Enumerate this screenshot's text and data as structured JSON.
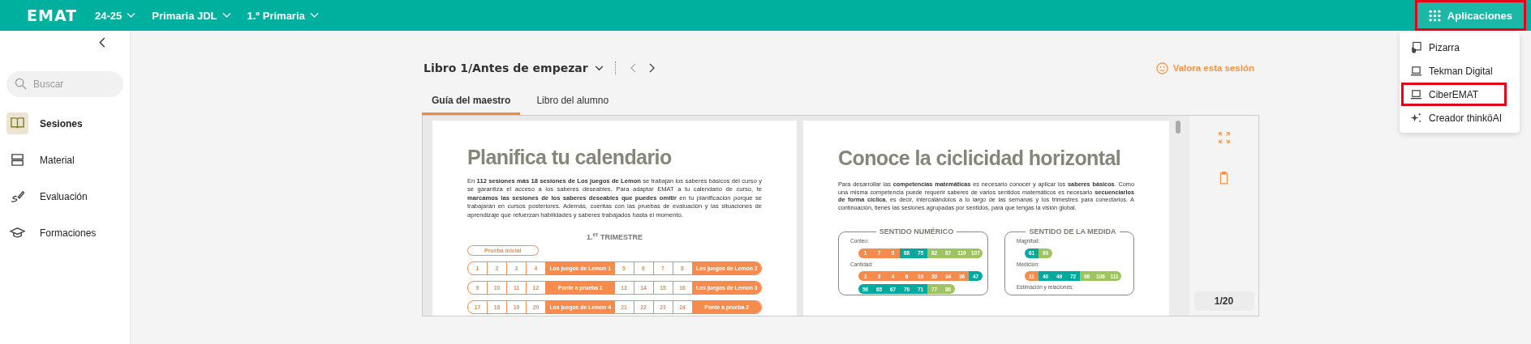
{
  "topbar": {
    "logo": "EMAT",
    "selectors": [
      {
        "label": "24-25"
      },
      {
        "label": "Primaria JDL"
      },
      {
        "label": "1.º Primaria"
      }
    ],
    "apps_button": {
      "label": "Aplicaciones",
      "highlighted": true
    }
  },
  "apps_menu": [
    {
      "label": "Pizarra",
      "kind": "board",
      "highlighted": false
    },
    {
      "label": "Tekman Digital",
      "kind": "laptop",
      "highlighted": false
    },
    {
      "label": "CiberEMAT",
      "kind": "laptop",
      "highlighted": true
    },
    {
      "label": "Creador thinköAI",
      "kind": "sparkle",
      "highlighted": false
    }
  ],
  "sidebar": {
    "search": {
      "placeholder": "Buscar"
    },
    "items": [
      {
        "label": "Sesiones",
        "kind": "book",
        "selected": true
      },
      {
        "label": "Material",
        "kind": "stack",
        "selected": false
      },
      {
        "label": "Evaluación",
        "kind": "pen",
        "selected": false
      },
      {
        "label": "Formaciones",
        "kind": "cap",
        "selected": false
      }
    ]
  },
  "header": {
    "breadcrumb": "Libro 1/Antes de empezar",
    "rate": "Valora esta sesión"
  },
  "tabs": [
    {
      "label": "Guía del maestro",
      "selected": true
    },
    {
      "label": "Libro del alumno",
      "selected": false
    }
  ],
  "viewer": {
    "page_counter": "1/20",
    "left_page": {
      "title": "Planifica tu calendario",
      "paragraph": "En **112 sesiones más 18 sesiones de Los juegos de Lemon** se trabajan los saberes básicos del curso y se garantiza el acceso a los saberes deseables. Para adaptar EMAT a tu calendario de curso, te **marcamos las sesiones de los saberes deseables que puedes omitir** en tu planificación porque se trabajarán en cursos posteriores. Además, cuentas con las pruebas de evaluación y las situaciones de aprendizaje que refuerzan habilidades y saberes trabajados hasta el momento.",
      "heading": "1.$^{er}$ TRIMESTRE",
      "pill": "Prueba inicial",
      "rows": [
        [
          {
            "text": "1",
            "kind": "session"
          },
          {
            "text": "2",
            "kind": "session"
          },
          {
            "text": "3",
            "kind": "session"
          },
          {
            "text": "4",
            "kind": "session"
          },
          {
            "text": "Los juegos de Lemon 1",
            "kind": "event"
          },
          {
            "text": "5",
            "kind": "session"
          },
          {
            "text": "6",
            "kind": "session"
          },
          {
            "text": "7",
            "kind": "session"
          },
          {
            "text": "8",
            "kind": "session"
          },
          {
            "text": "Los juegos de Lemon 2",
            "kind": "event"
          }
        ],
        [
          {
            "text": "9",
            "kind": "session"
          },
          {
            "text": "10",
            "kind": "session"
          },
          {
            "text": "11",
            "kind": "session"
          },
          {
            "text": "12",
            "kind": "session"
          },
          {
            "text": "Ponte a prueba 1",
            "kind": "event"
          },
          {
            "text": "13",
            "kind": "session"
          },
          {
            "text": "14",
            "kind": "session"
          },
          {
            "text": "15",
            "kind": "session"
          },
          {
            "text": "16",
            "kind": "session"
          },
          {
            "text": "Los juegos de Lemon 3",
            "kind": "event"
          }
        ],
        [
          {
            "text": "17",
            "kind": "session"
          },
          {
            "text": "18",
            "kind": "session"
          },
          {
            "text": "19",
            "kind": "session"
          },
          {
            "text": "20",
            "kind": "session"
          },
          {
            "text": "Los juegos de Lemon 4",
            "kind": "event"
          },
          {
            "text": "21",
            "kind": "session"
          },
          {
            "text": "22",
            "kind": "session"
          },
          {
            "text": "23",
            "kind": "session"
          },
          {
            "text": "24",
            "kind": "session"
          },
          {
            "text": "Ponte a prueba 2",
            "kind": "event"
          }
        ]
      ]
    },
    "right_page": {
      "title": "Conoce la ciclicidad horizontal",
      "paragraph": "Para desarrollar las **competencias matemáticas** es necesario conocer y aplicar los **saberes básicos**. Como una misma competencia puede requerir saberes de varios sentidos matemáticos es necesario **secuenciarlos de forma cíclica**, es decir, intercalándolos a lo largo de las semanas y los trimestres para conectarlos. A continuación, tienes las sesiones agrupadas por sentidos, para que tengas la visión global.",
      "groups": [
        {
          "title": "SENTIDO NUMÉRICO",
          "topics": [
            {
              "label": "Conteo:",
              "strips": [
                [
                  {
                    "text": "1",
                    "color": "#f58b4c"
                  },
                  {
                    "text": "7",
                    "color": "#f58b4c"
                  },
                  {
                    "text": "8",
                    "color": "#f58b4c"
                  },
                  {
                    "text": "68",
                    "color": "#00a99d"
                  },
                  {
                    "text": "75",
                    "color": "#00a99d"
                  },
                  {
                    "text": "82",
                    "color": "#9dc45f"
                  },
                  {
                    "text": "87",
                    "color": "#9dc45f"
                  },
                  {
                    "text": "110",
                    "color": "#9dc45f"
                  },
                  {
                    "text": "107",
                    "color": "#9dc45f"
                  }
                ]
              ]
            },
            {
              "label": "Cantidad:",
              "strips": [
                [
                  {
                    "text": "2",
                    "color": "#f58b4c"
                  },
                  {
                    "text": "3",
                    "color": "#f58b4c"
                  },
                  {
                    "text": "4",
                    "color": "#f58b4c"
                  },
                  {
                    "text": "6",
                    "color": "#f58b4c"
                  },
                  {
                    "text": "19",
                    "color": "#f58b4c"
                  },
                  {
                    "text": "30",
                    "color": "#f58b4c"
                  },
                  {
                    "text": "34",
                    "color": "#f58b4c"
                  },
                  {
                    "text": "36",
                    "color": "#f58b4c"
                  },
                  {
                    "text": "47",
                    "color": "#00a99d"
                  }
                ],
                [
                  {
                    "text": "56",
                    "color": "#00a99d"
                  },
                  {
                    "text": "65",
                    "color": "#00a99d"
                  },
                  {
                    "text": "67",
                    "color": "#00a99d"
                  },
                  {
                    "text": "70",
                    "color": "#00a99d"
                  },
                  {
                    "text": "71",
                    "color": "#00a99d"
                  },
                  {
                    "text": "77",
                    "color": "#9dc45f"
                  },
                  {
                    "text": "86",
                    "color": "#9dc45f"
                  }
                ]
              ]
            }
          ]
        },
        {
          "title": "SENTIDO DE LA MEDIDA",
          "topics": [
            {
              "label": "Magnitud:",
              "strips": [
                [
                  {
                    "text": "61",
                    "color": "#00a99d"
                  },
                  {
                    "text": "93",
                    "color": "#9dc45f"
                  }
                ]
              ]
            },
            {
              "label": "Medición:",
              "strips": [
                [
                  {
                    "text": "11",
                    "color": "#f58b4c"
                  },
                  {
                    "text": "40",
                    "color": "#00a99d"
                  },
                  {
                    "text": "49",
                    "color": "#00a99d"
                  },
                  {
                    "text": "72",
                    "color": "#00a99d"
                  },
                  {
                    "text": "98",
                    "color": "#9dc45f"
                  },
                  {
                    "text": "106",
                    "color": "#9dc45f"
                  },
                  {
                    "text": "111",
                    "color": "#9dc45f"
                  }
                ]
              ]
            },
            {
              "label": "Estimación y relaciones:"
            }
          ]
        }
      ]
    }
  }
}
